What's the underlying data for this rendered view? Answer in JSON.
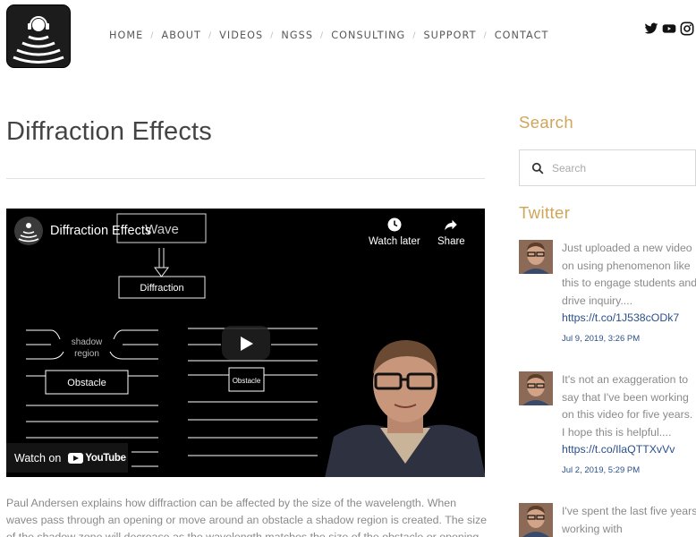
{
  "nav": {
    "items": [
      "HOME",
      "ABOUT",
      "VIDEOS",
      "NGSS",
      "CONSULTING",
      "SUPPORT",
      "CONTACT"
    ],
    "separator": "/"
  },
  "social": [
    "twitter-icon",
    "youtube-icon",
    "instagram-icon"
  ],
  "page": {
    "title": "Diffraction Effects"
  },
  "video": {
    "title": "Diffraction Effects",
    "watch_later": "Watch later",
    "share": "Share",
    "watch_on": "Watch on",
    "youtube": "YouTube",
    "diagram": {
      "wave": "Wave",
      "diffraction": "Diffraction",
      "shadow_line1": "shadow",
      "shadow_line2": "region",
      "obstacle_large": "Obstacle",
      "obstacle_small": "Obstacle"
    }
  },
  "article": {
    "body": "Paul Andersen explains how diffraction can be affected by the size of the wavelength. When waves pass through an opening or move around an obstacle a shadow region is created. The size of the shadow zone will decrease as the wavelength matches the size of the obstacle or opening."
  },
  "sidebar": {
    "search_heading": "Search",
    "search_placeholder": "Search",
    "twitter_heading": "Twitter",
    "tweets": [
      {
        "text": "Just uploaded a new video on using phenomenon like this to engage students and drive inquiry....",
        "link": "https://t.co/1J538cODk7",
        "date": "Jul 9, 2019, 3:26 PM"
      },
      {
        "text": "It's not an exaggeration to say that I've been working on this video for five years. I hope this is helpful....",
        "link": "https://t.co/IlaQTTXvVv",
        "date": "Jul 2, 2019, 5:29 PM"
      },
      {
        "text": "I've spent the last five years working with",
        "link": "",
        "date": ""
      }
    ]
  },
  "colors": {
    "accent": "#d0a55a",
    "link": "#2b4f8a",
    "video_bg": "#000000"
  }
}
